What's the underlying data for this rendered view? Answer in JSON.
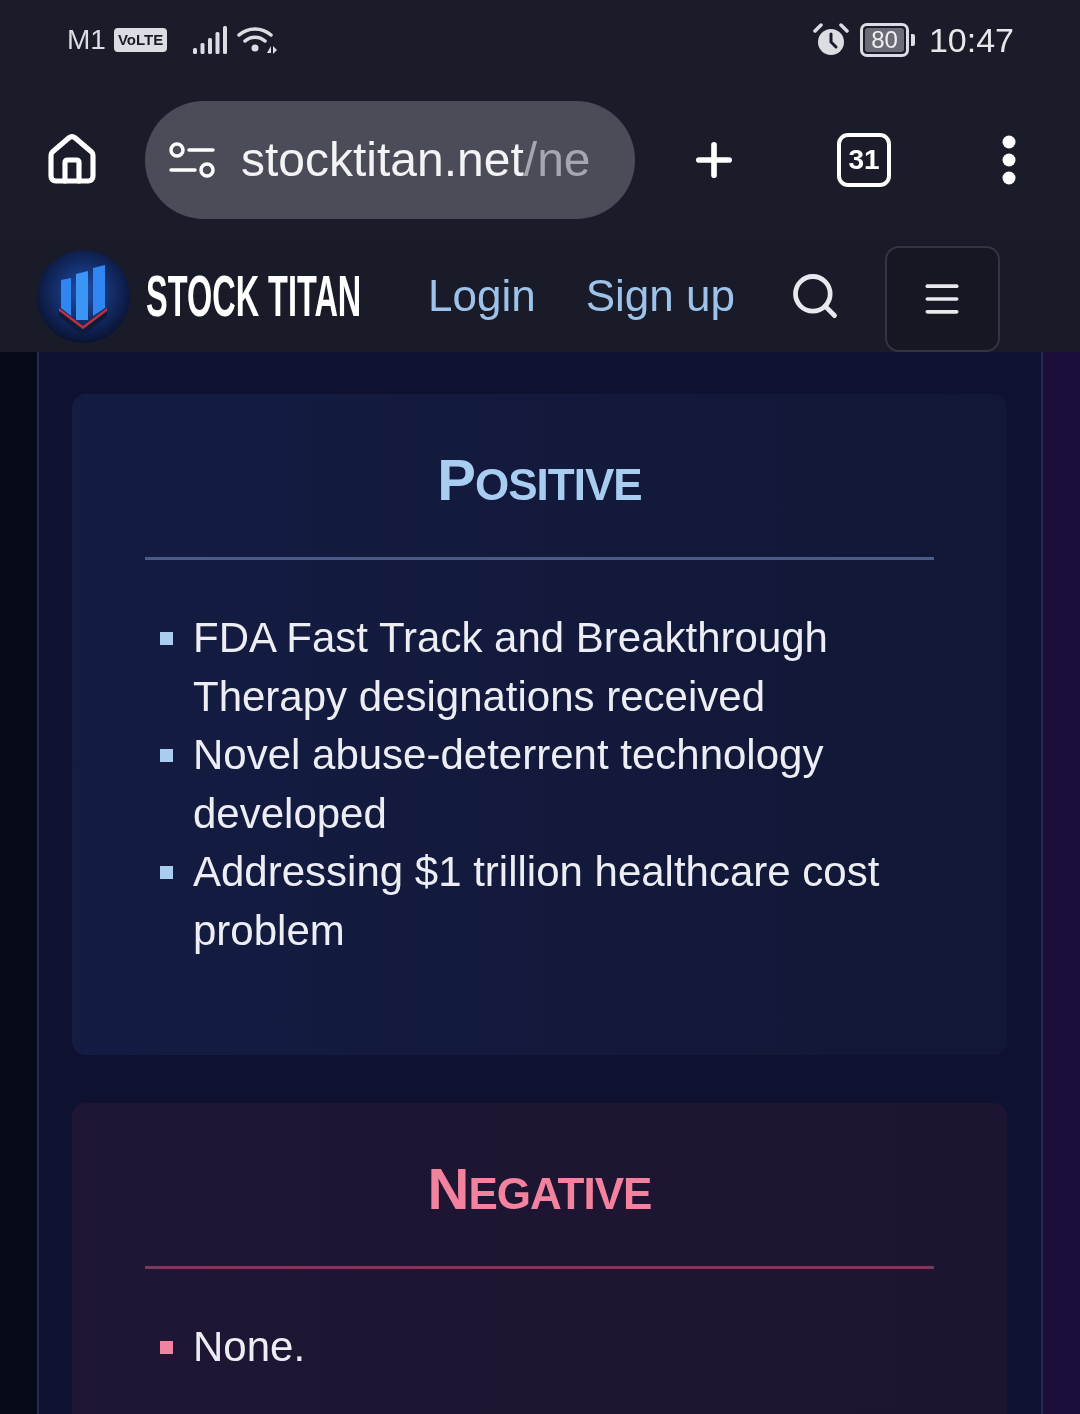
{
  "status_bar": {
    "carrier": "M1",
    "network_badge": "VoLTE",
    "battery": "80",
    "time": "10:47"
  },
  "browser_bar": {
    "url_host": "stocktitan.net",
    "url_path": "/ne",
    "tab_count": "31"
  },
  "site_header": {
    "brand": "STOCK TITAN",
    "nav": [
      {
        "label": "Login"
      },
      {
        "label": "Sign up"
      }
    ]
  },
  "sections": [
    {
      "kind": "positive",
      "title": "POSITIVE",
      "items": [
        "FDA Fast Track and Breakthrough Therapy designations received",
        "Novel abuse-deterrent technology developed",
        "Addressing $1 trillion healthcare cost problem"
      ]
    },
    {
      "kind": "negative",
      "title": "NEGATIVE",
      "items": [
        "None."
      ]
    }
  ]
}
